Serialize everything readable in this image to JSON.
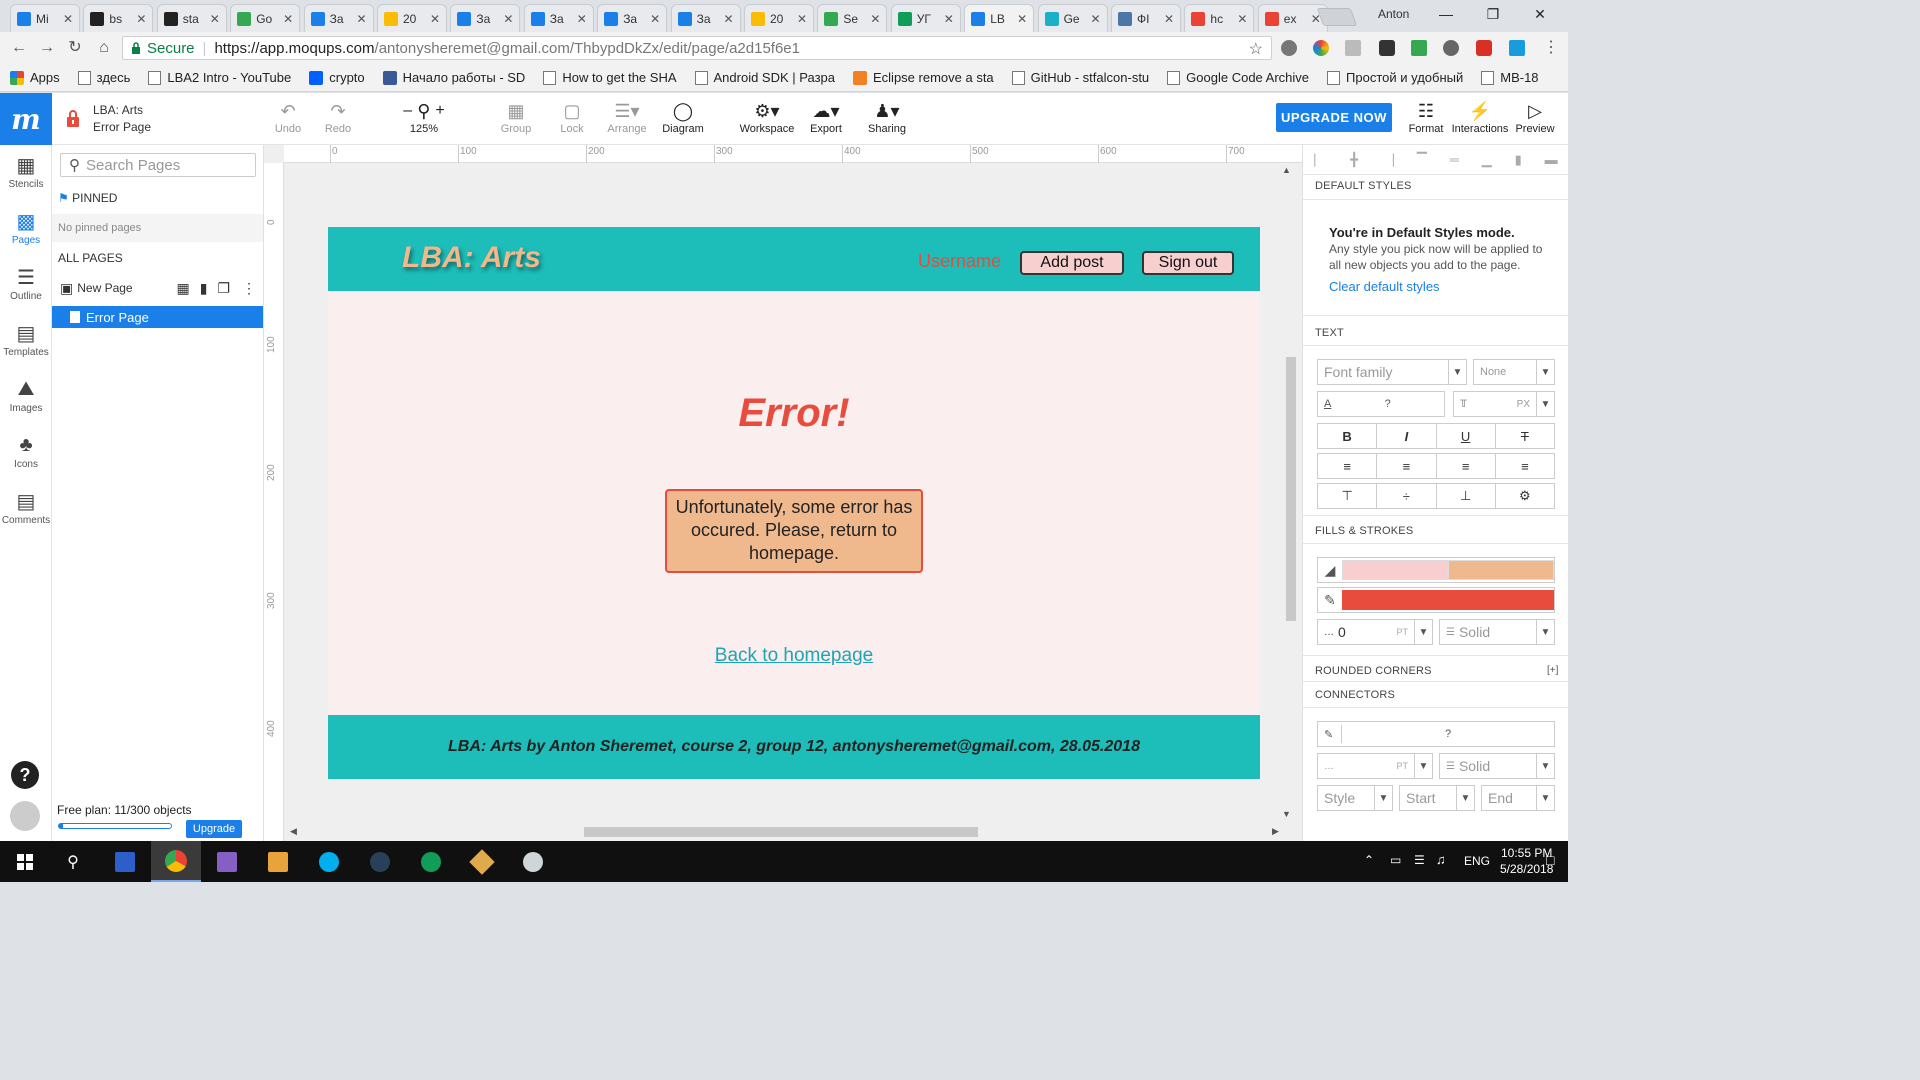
{
  "browser": {
    "tabs": [
      {
        "title": "Mi",
        "color": "#1a7fe8"
      },
      {
        "title": "bs",
        "color": "#222222"
      },
      {
        "title": "sta",
        "color": "#222222"
      },
      {
        "title": "Go",
        "color": "#34a853"
      },
      {
        "title": "За",
        "color": "#1a7fe8"
      },
      {
        "title": "20",
        "color": "#fbbc05"
      },
      {
        "title": "За",
        "color": "#1a7fe8"
      },
      {
        "title": "За",
        "color": "#1a7fe8"
      },
      {
        "title": "За",
        "color": "#1a7fe8"
      },
      {
        "title": "За",
        "color": "#1a7fe8"
      },
      {
        "title": "20",
        "color": "#fbbc05"
      },
      {
        "title": "Se",
        "color": "#34a853"
      },
      {
        "title": "УГ",
        "color": "#0f9d58"
      },
      {
        "title": "LB",
        "color": "#1a7fe8",
        "active": true
      },
      {
        "title": "Ge",
        "color": "#1ab0c9"
      },
      {
        "title": "ФІ",
        "color": "#4a76a8"
      },
      {
        "title": "hc",
        "color": "#ea4335"
      },
      {
        "title": "ex",
        "color": "#ea4335"
      }
    ],
    "profile": "Anton",
    "secure_label": "Secure",
    "url_host": "https://app.moqups.com",
    "url_path": "/antonysheremet@gmail.com/ThbypdDkZx/edit/page/a2d15f6e1",
    "bookmarks": [
      {
        "label": "Apps",
        "icon": "apps"
      },
      {
        "label": "здесь",
        "icon": "page"
      },
      {
        "label": "LBA2 Intro - YouTube",
        "icon": "page"
      },
      {
        "label": "crypto",
        "icon": "dropbox"
      },
      {
        "label": "Начало работы - SD",
        "icon": "facebook"
      },
      {
        "label": "How to get the SHA",
        "icon": "page"
      },
      {
        "label": "Android SDK | Разра",
        "icon": "page"
      },
      {
        "label": "Eclipse remove a sta",
        "icon": "stack"
      },
      {
        "label": "GitHub - stfalcon-stu",
        "icon": "page"
      },
      {
        "label": "Google Code Archive",
        "icon": "page"
      },
      {
        "label": "Простой и удобный",
        "icon": "page"
      },
      {
        "label": "MB-18",
        "icon": "page"
      }
    ]
  },
  "toolbar": {
    "project_name": "LBA: Arts",
    "page_name": "Error Page",
    "undo": "Undo",
    "redo": "Redo",
    "zoom": "125%",
    "group": "Group",
    "lock": "Lock",
    "arrange": "Arrange",
    "diagram": "Diagram",
    "workspace": "Workspace",
    "export": "Export",
    "sharing": "Sharing",
    "upgrade_now": "UPGRADE NOW",
    "format": "Format",
    "interactions": "Interactions",
    "preview": "Preview"
  },
  "rail": {
    "stencils": "Stencils",
    "pages": "Pages",
    "outline": "Outline",
    "templates": "Templates",
    "images": "Images",
    "icons": "Icons",
    "comments": "Comments"
  },
  "pages_panel": {
    "search_placeholder": "Search Pages",
    "pinned": "PINNED",
    "no_pinned": "No pinned pages",
    "all_pages": "ALL PAGES",
    "new_page": "New Page",
    "pages": [
      "Error Page"
    ],
    "plan": "Free plan: 11/300 objects",
    "plan_used_fraction": 0.037,
    "upgrade": "Upgrade"
  },
  "rulers": {
    "top": [
      "0",
      "100",
      "200",
      "300",
      "400",
      "500",
      "600",
      "700"
    ],
    "left": [
      "0",
      "100",
      "200",
      "300",
      "400"
    ]
  },
  "mockup": {
    "site_title": "LBA: Arts",
    "username": "Username",
    "add_post": "Add post",
    "sign_out": "Sign out",
    "error_title": "Error!",
    "error_message": "Unfortunately, some error has occured. Please, return to homepage.",
    "back_link": "Back to homepage",
    "footer": "LBA: Arts by Anton Sheremet, course 2, group 12, antonysheremet@gmail.com, 28.05.2018",
    "colors": {
      "header": "#1dbdb9",
      "background": "#fbeeee",
      "accent_red": "#e74c3c",
      "title_orange": "#f2b889",
      "box_fill": "#f0b98d",
      "button_fill": "#f8cfcf"
    }
  },
  "format_panel": {
    "default_styles": "DEFAULT STYLES",
    "default_mode_title": "You're in Default Styles mode.",
    "default_mode_text": "Any style you pick now will be applied to all new objects you add to the page.",
    "clear_default": "Clear default styles",
    "text": "TEXT",
    "font_family": "Font family",
    "font_weight": "None",
    "font_color_value": "?",
    "font_size_unit": "PX",
    "fills_strokes": "FILLS & STROKES",
    "fill_color_1": "#f8cfcf",
    "fill_color_2": "#f0b98d",
    "stroke_color": "#e74c3c",
    "stroke_width": "0",
    "stroke_unit": "PT",
    "stroke_style": "Solid",
    "rounded_corners": "ROUNDED CORNERS",
    "rounded_toggle": "[+]",
    "connectors": "CONNECTORS",
    "connector_color_value": "?",
    "connector_unit": "PT",
    "connector_style": "Solid",
    "style": "Style",
    "start": "Start",
    "end": "End"
  },
  "taskbar": {
    "lang": "ENG",
    "time": "10:55 PM",
    "date": "5/28/2018"
  }
}
